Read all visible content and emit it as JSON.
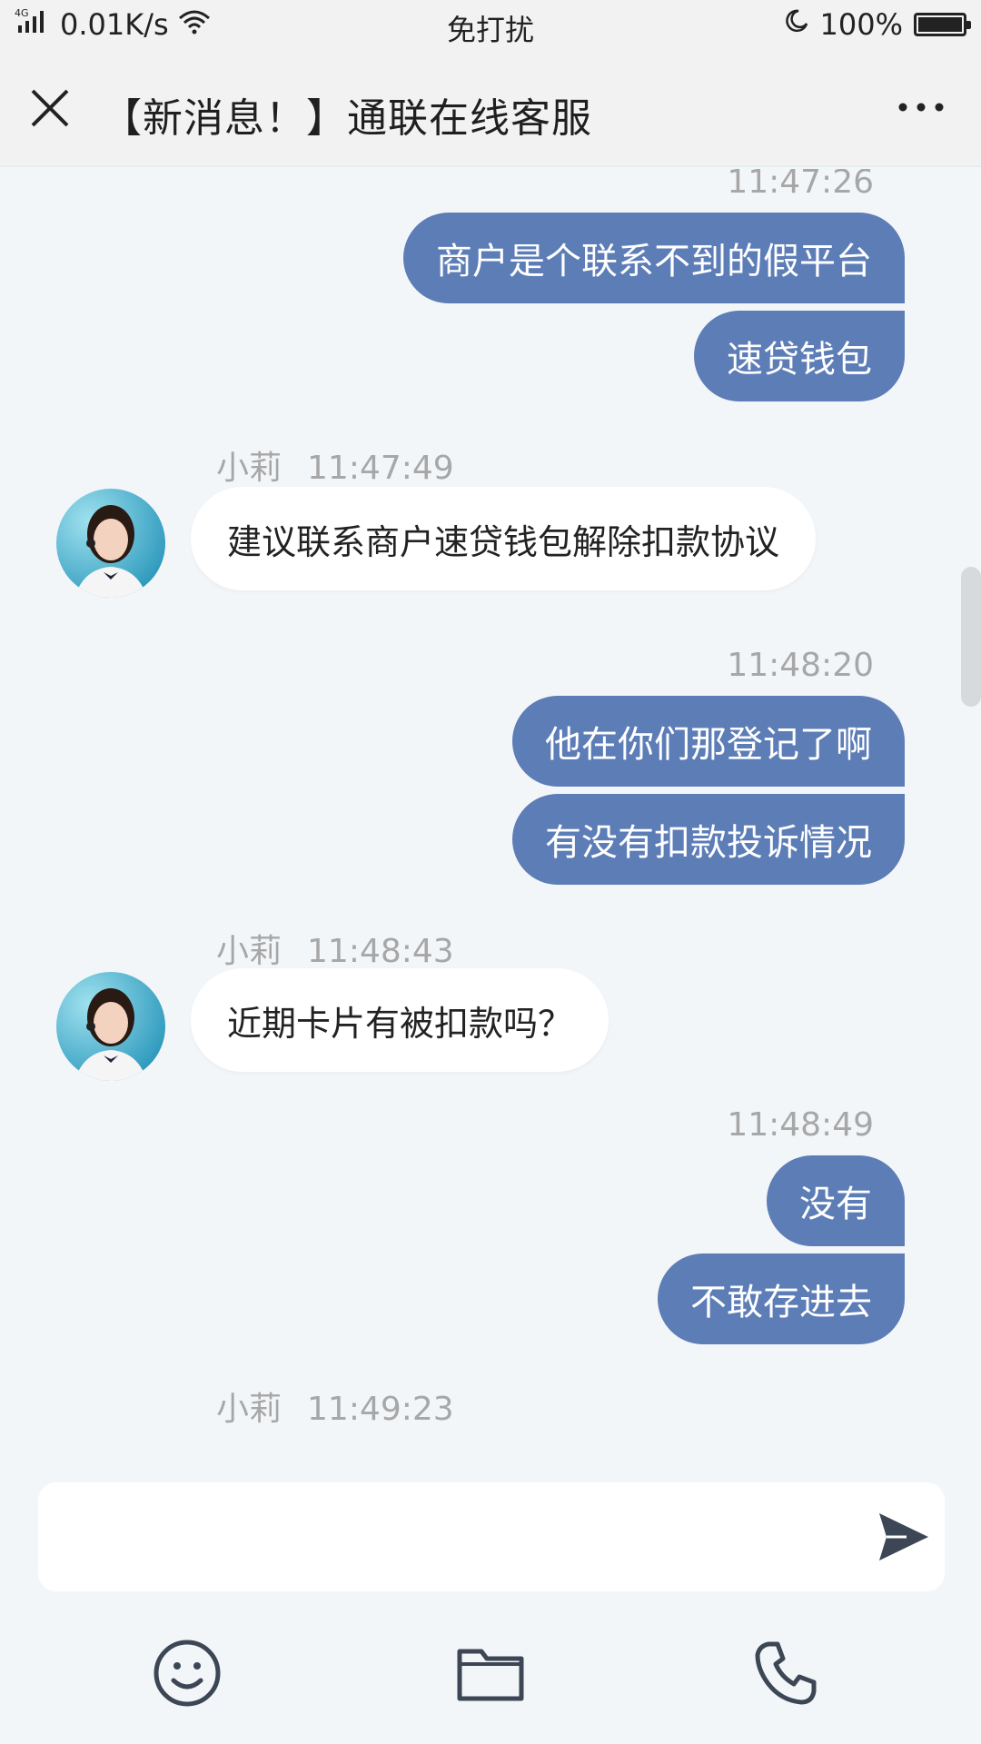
{
  "status_bar": {
    "network": "4G",
    "speed": "0.01K/s",
    "mode": "免打扰",
    "battery": "100%"
  },
  "header": {
    "title": "【新消息！】通联在线客服"
  },
  "chat": {
    "agent_name": "小莉",
    "messages": [
      {
        "dir": "out",
        "time": "11:47:26",
        "lines": [
          "商户是个联系不到的假平台",
          "速贷钱包"
        ]
      },
      {
        "dir": "in",
        "time": "11:47:49",
        "lines": [
          "建议联系商户速贷钱包解除扣款协议"
        ]
      },
      {
        "dir": "out",
        "time": "11:48:20",
        "lines": [
          "他在你们那登记了啊",
          "有没有扣款投诉情况"
        ]
      },
      {
        "dir": "in",
        "time": "11:48:43",
        "lines": [
          "近期卡片有被扣款吗？"
        ]
      },
      {
        "dir": "out",
        "time": "11:48:49",
        "lines": [
          "没有",
          "不敢存进去"
        ]
      },
      {
        "dir": "in",
        "time": "11:49:23",
        "lines": []
      }
    ]
  },
  "input": {
    "value": "",
    "placeholder": ""
  },
  "toolbar": {
    "items": [
      "emoji-icon",
      "folder-icon",
      "phone-icon"
    ]
  },
  "colors": {
    "outgoing_bubble": "#5d7db7",
    "incoming_bubble": "#ffffff",
    "background": "#f3f6f9",
    "timestamp": "#a7a7a7"
  }
}
